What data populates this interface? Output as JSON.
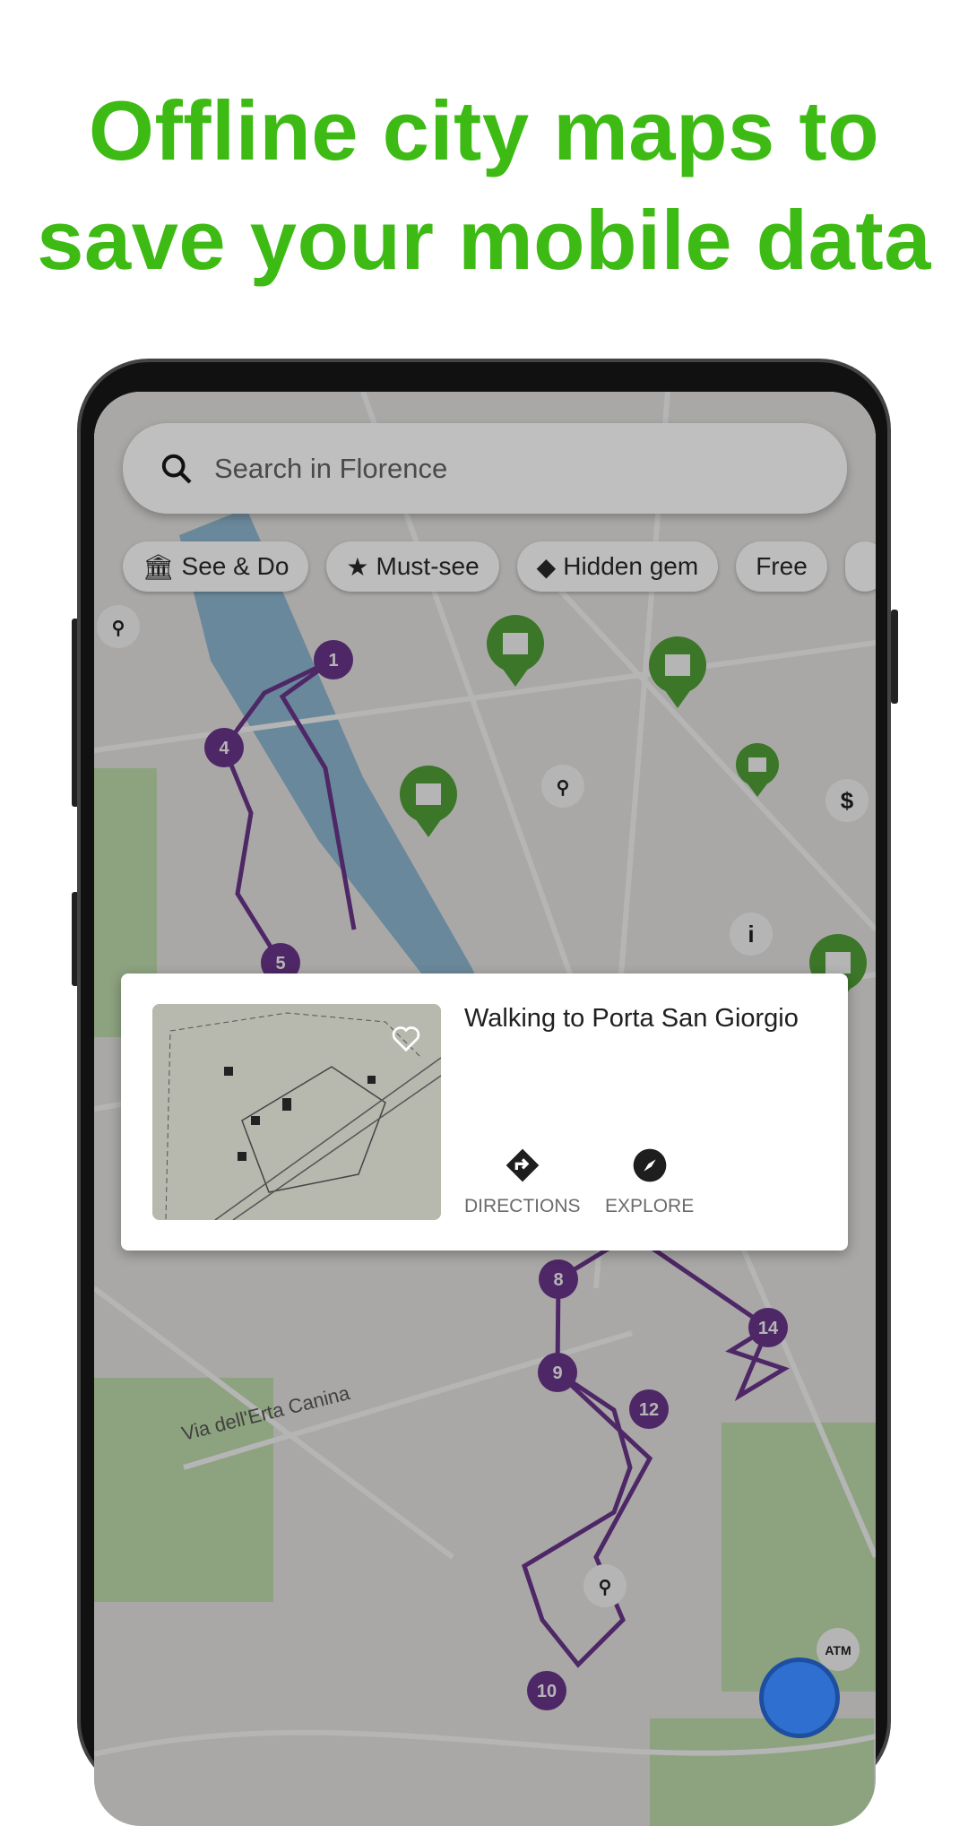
{
  "headline": {
    "line1": "Offline city maps to",
    "line2": "save your mobile data",
    "color": "#3dbb14"
  },
  "search": {
    "placeholder": "Search in Florence",
    "icon": "search-icon"
  },
  "chips": [
    {
      "label": "See & Do",
      "icon": "museum-icon"
    },
    {
      "label": "Must-see",
      "icon": "star-icon"
    },
    {
      "label": "Hidden gem",
      "icon": "diamond-icon"
    },
    {
      "label": "Free",
      "icon": ""
    }
  ],
  "map": {
    "street_label": "Via dell'Erta Canina",
    "route_color": "#5a1a80",
    "poi_color": "#3c9a1e",
    "route_stops": [
      "1",
      "4",
      "5",
      "8",
      "9",
      "12",
      "14",
      "10"
    ],
    "poi_badges": {
      "dollar": "$",
      "info": "i",
      "atm": "ATM"
    }
  },
  "card": {
    "title": "Walking to Porta San Giorgio",
    "actions": [
      {
        "label": "DIRECTIONS",
        "icon": "directions-icon"
      },
      {
        "label": "EXPLORE",
        "icon": "compass-icon"
      }
    ],
    "favorite_icon": "heart-outline-icon"
  }
}
